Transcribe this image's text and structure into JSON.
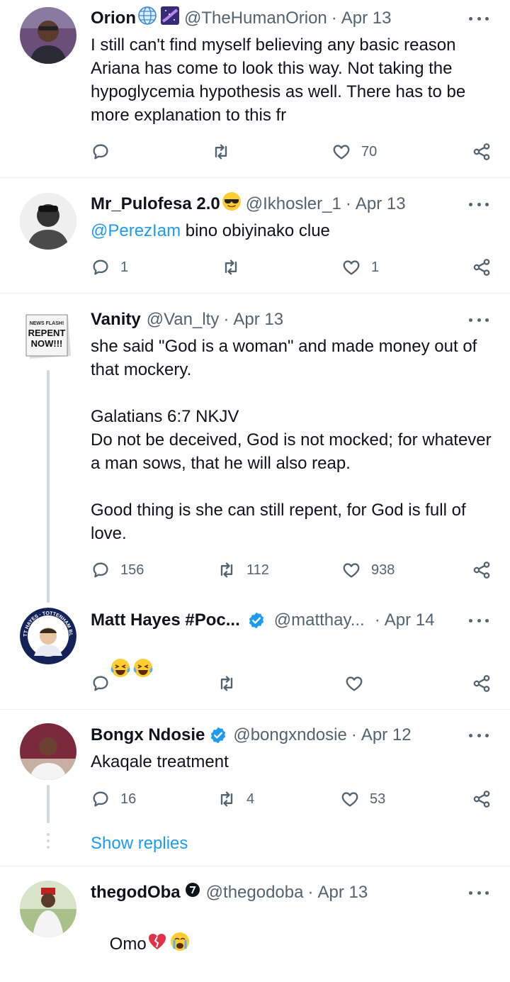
{
  "tweets": [
    {
      "name": "Orion",
      "handle": "@TheHumanOrion",
      "date": "Apr 13",
      "text": "I still can't find myself believing any basic reason Ariana has come to look this way. Not taking the hypoglycemia hypothesis as well. There has to be more explanation to this fr",
      "replies": "",
      "retweets": "",
      "likes": "70"
    },
    {
      "name": "Mr_Pulofesa 2.0",
      "handle": "@Ikhosler_1",
      "date": "Apr 13",
      "mention": "@PerezIam",
      "text": " bino obiyinako clue",
      "replies": "1",
      "retweets": "",
      "likes": "1"
    },
    {
      "name": "Vanity",
      "handle": "@Van_lty",
      "date": "Apr 13",
      "avatar_text": [
        "NEWS FLASH!",
        "REPENT",
        "NOW!!!"
      ],
      "text": "she said \"God is a woman\" and made money out of that mockery.\n\nGalatians 6:7 NKJV\nDo not be deceived, God is not mocked; for whatever a man sows, that he will also reap.\n\nGood thing is she can still repent, for God is full of love.",
      "replies": "156",
      "retweets": "112",
      "likes": "938"
    },
    {
      "name": "Matt Hayes #Poc...",
      "handle": "@matthay...",
      "date": "Apr 14",
      "avatar_text": "MATT HAYES · TOTTENHAM BLOG",
      "text": "",
      "replies": "",
      "retweets": "",
      "likes": ""
    },
    {
      "name": "Bongx Ndosie",
      "handle": "@bongxndosie",
      "date": "Apr 12",
      "text": "Akaqale treatment",
      "replies": "16",
      "retweets": "4",
      "likes": "53"
    },
    {
      "name": "thegodOba",
      "handle": "@thegodoba",
      "date": "Apr 13",
      "text": "Omo"
    }
  ],
  "show_replies": "Show replies",
  "separator": "·",
  "colors": {
    "link": "#1d9bf0",
    "muted": "#536471",
    "verified": "#1d9bf0",
    "line": "#cfd9de"
  },
  "icons": [
    "globe-icon",
    "galaxy-emoji-icon",
    "sunglasses-emoji-icon",
    "verified-badge-icon",
    "laughing-tears-emoji-icon",
    "broken-heart-emoji-icon",
    "crying-emoji-icon",
    "reply-icon",
    "retweet-icon",
    "like-icon",
    "share-icon",
    "more-icon"
  ]
}
